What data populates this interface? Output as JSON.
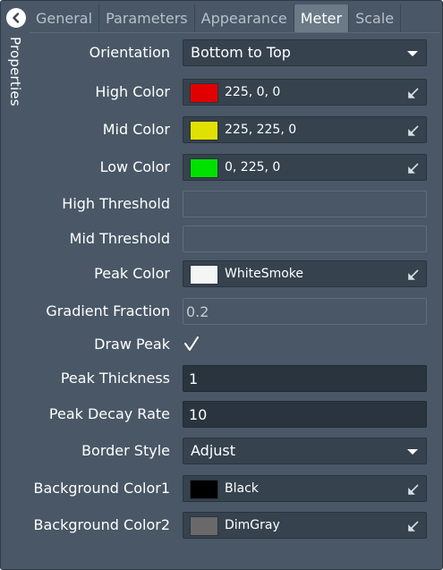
{
  "side_panel": {
    "label": "Properties"
  },
  "tabs": [
    {
      "label": "General"
    },
    {
      "label": "Parameters"
    },
    {
      "label": "Appearance"
    },
    {
      "label": "Meter",
      "active": true
    },
    {
      "label": "Scale"
    }
  ],
  "fields": {
    "orientation": {
      "label": "Orientation",
      "value": "Bottom to Top"
    },
    "high_color": {
      "label": "High Color",
      "value": "225, 0, 0",
      "swatch": "#e10000"
    },
    "mid_color": {
      "label": "Mid Color",
      "value": "225, 225, 0",
      "swatch": "#e1e100"
    },
    "low_color": {
      "label": "Low Color",
      "value": "0, 225, 0",
      "swatch": "#00e100"
    },
    "high_threshold": {
      "label": "High Threshold",
      "value": ""
    },
    "mid_threshold": {
      "label": "Mid Threshold",
      "value": ""
    },
    "peak_color": {
      "label": "Peak Color",
      "value": "WhiteSmoke",
      "swatch": "#f5f5f5"
    },
    "gradient_fraction": {
      "label": "Gradient Fraction",
      "value": "0.2"
    },
    "draw_peak": {
      "label": "Draw Peak",
      "checked": true
    },
    "peak_thickness": {
      "label": "Peak Thickness",
      "value": "1"
    },
    "peak_decay_rate": {
      "label": "Peak Decay Rate",
      "value": "10"
    },
    "border_style": {
      "label": "Border Style",
      "value": "Adjust"
    },
    "background_color1": {
      "label": "Background Color1",
      "value": "Black",
      "swatch": "#000000"
    },
    "background_color2": {
      "label": "Background Color2",
      "value": "DimGray",
      "swatch": "#696969"
    }
  },
  "colors": {
    "panel_bg": "#495766",
    "control_bg": "#36424e",
    "active_tab": "#6c7a88"
  }
}
